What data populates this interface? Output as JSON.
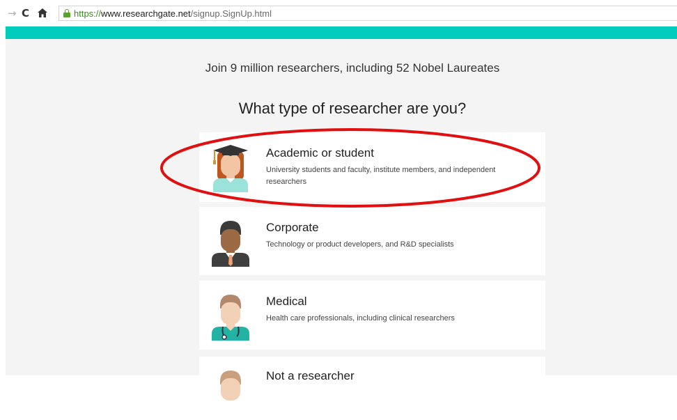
{
  "browser": {
    "url_scheme": "https://",
    "url_host": "www.researchgate.net",
    "url_path": "/signup.SignUp.html",
    "forward_icon": "arrow-right-icon",
    "reload_icon": "reload-icon",
    "home_icon": "home-icon"
  },
  "colors": {
    "teal": "#00ccbb",
    "highlight": "#e01010",
    "background": "#f4f4f4"
  },
  "tagline": "Join 9 million researchers, including 52 Nobel Laureates",
  "heading": "What type of researcher are you?",
  "options": [
    {
      "title": "Academic or student",
      "description": "University students and faculty, institute members, and independent researchers",
      "icon": "academic-avatar-icon"
    },
    {
      "title": "Corporate",
      "description": "Technology or product developers, and R&D specialists",
      "icon": "corporate-avatar-icon"
    },
    {
      "title": "Medical",
      "description": "Health care professionals, including clinical researchers",
      "icon": "medical-avatar-icon"
    },
    {
      "title": "Not a researcher",
      "icon": "person-avatar-icon"
    }
  ]
}
